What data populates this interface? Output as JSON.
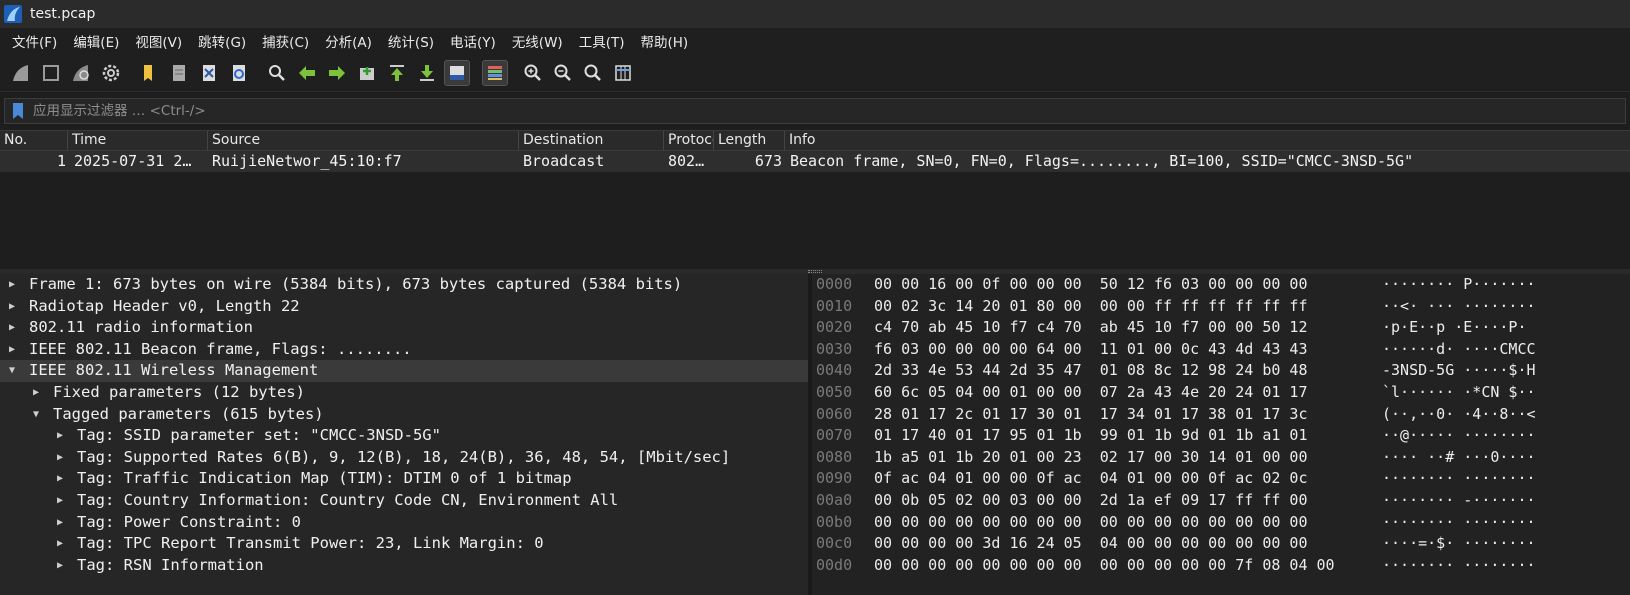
{
  "window": {
    "title": "test.pcap"
  },
  "menu": [
    "文件(F)",
    "编辑(E)",
    "视图(V)",
    "跳转(G)",
    "捕获(C)",
    "分析(A)",
    "统计(S)",
    "电话(Y)",
    "无线(W)",
    "工具(T)",
    "帮助(H)"
  ],
  "toolbar": {
    "icons": [
      "shark-fin-start-icon",
      "stop-square-icon",
      "restart-fin-icon",
      "gear-options-icon",
      "open-file-icon",
      "file-icon",
      "close-file-icon",
      "reload-file-icon",
      "find-packet-icon",
      "go-back-icon",
      "go-forward-icon",
      "go-to-packet-icon",
      "first-packet-icon",
      "last-packet-icon",
      "autoscroll-icon",
      "colorize-icon",
      "zoom-in-icon",
      "zoom-out-icon",
      "zoom-normal-icon",
      "resize-columns-icon"
    ]
  },
  "filter": {
    "placeholder": "应用显示过滤器 … <Ctrl-/>"
  },
  "packet_list": {
    "columns": [
      "No.",
      "Time",
      "Source",
      "Destination",
      "Protocol",
      "Length",
      "Info"
    ],
    "rows": [
      {
        "no": "1",
        "time": "2025-07-31 2…",
        "source": "RuijieNetwor_45:10:f7",
        "destination": "Broadcast",
        "protocol": "802…",
        "length": "673",
        "info": "Beacon frame, SN=0, FN=0, Flags=........, BI=100, SSID=\"CMCC-3NSD-5G\""
      }
    ]
  },
  "details": [
    {
      "text": "Frame 1: 673 bytes on wire (5384 bits), 673 bytes captured (5384 bits)",
      "level": 0,
      "expanded": false
    },
    {
      "text": "Radiotap Header v0, Length 22",
      "level": 0,
      "expanded": false
    },
    {
      "text": "802.11 radio information",
      "level": 0,
      "expanded": false
    },
    {
      "text": "IEEE 802.11 Beacon frame, Flags: ........",
      "level": 0,
      "expanded": false
    },
    {
      "text": "IEEE 802.11 Wireless Management",
      "level": 0,
      "expanded": true
    },
    {
      "text": "Fixed parameters (12 bytes)",
      "level": 1,
      "expanded": false
    },
    {
      "text": "Tagged parameters (615 bytes)",
      "level": 1,
      "expanded": true
    },
    {
      "text": "Tag: SSID parameter set: \"CMCC-3NSD-5G\"",
      "level": 2,
      "expanded": false
    },
    {
      "text": "Tag: Supported Rates 6(B), 9, 12(B), 18, 24(B), 36, 48, 54, [Mbit/sec]",
      "level": 2,
      "expanded": false
    },
    {
      "text": "Tag: Traffic Indication Map (TIM): DTIM 0 of 1 bitmap",
      "level": 2,
      "expanded": false
    },
    {
      "text": "Tag: Country Information: Country Code CN, Environment All",
      "level": 2,
      "expanded": false
    },
    {
      "text": "Tag: Power Constraint: 0",
      "level": 2,
      "expanded": false
    },
    {
      "text": "Tag: TPC Report Transmit Power: 23, Link Margin: 0",
      "level": 2,
      "expanded": false
    },
    {
      "text": "Tag: RSN Information",
      "level": 2,
      "expanded": false
    }
  ],
  "bytes": [
    {
      "offset": "0000",
      "hex": "00 00 16 00 0f 00 00 00  50 12 f6 03 00 00 00 00",
      "ascii": "········ P·······"
    },
    {
      "offset": "0010",
      "hex": "00 02 3c 14 20 01 80 00  00 00 ff ff ff ff ff ff",
      "ascii": "··<· ··· ········"
    },
    {
      "offset": "0020",
      "hex": "c4 70 ab 45 10 f7 c4 70  ab 45 10 f7 00 00 50 12",
      "ascii": "·p·E··p ·E····P·"
    },
    {
      "offset": "0030",
      "hex": "f6 03 00 00 00 00 64 00  11 01 00 0c 43 4d 43 43",
      "ascii": "······d· ····CMCC"
    },
    {
      "offset": "0040",
      "hex": "2d 33 4e 53 44 2d 35 47  01 08 8c 12 98 24 b0 48",
      "ascii": "-3NSD-5G ·····$·H"
    },
    {
      "offset": "0050",
      "hex": "60 6c 05 04 00 01 00 00  07 2a 43 4e 20 24 01 17",
      "ascii": "`l······ ·*CN $··"
    },
    {
      "offset": "0060",
      "hex": "28 01 17 2c 01 17 30 01  17 34 01 17 38 01 17 3c",
      "ascii": "(··,··0· ·4··8··<"
    },
    {
      "offset": "0070",
      "hex": "01 17 40 01 17 95 01 1b  99 01 1b 9d 01 1b a1 01",
      "ascii": "··@····· ········"
    },
    {
      "offset": "0080",
      "hex": "1b a5 01 1b 20 01 00 23  02 17 00 30 14 01 00 00",
      "ascii": "···· ··# ···0····"
    },
    {
      "offset": "0090",
      "hex": "0f ac 04 01 00 00 0f ac  04 01 00 00 0f ac 02 0c",
      "ascii": "········ ········"
    },
    {
      "offset": "00a0",
      "hex": "00 0b 05 02 00 03 00 00  2d 1a ef 09 17 ff ff 00",
      "ascii": "········ -·······"
    },
    {
      "offset": "00b0",
      "hex": "00 00 00 00 00 00 00 00  00 00 00 00 00 00 00 00",
      "ascii": "········ ········"
    },
    {
      "offset": "00c0",
      "hex": "00 00 00 00 3d 16 24 05  04 00 00 00 00 00 00 00",
      "ascii": "····=·$· ········"
    },
    {
      "offset": "00d0",
      "hex": "00 00 00 00 00 00 00 00  00 00 00 00 00 7f 08 04 00",
      "ascii": "········ ········"
    }
  ]
}
